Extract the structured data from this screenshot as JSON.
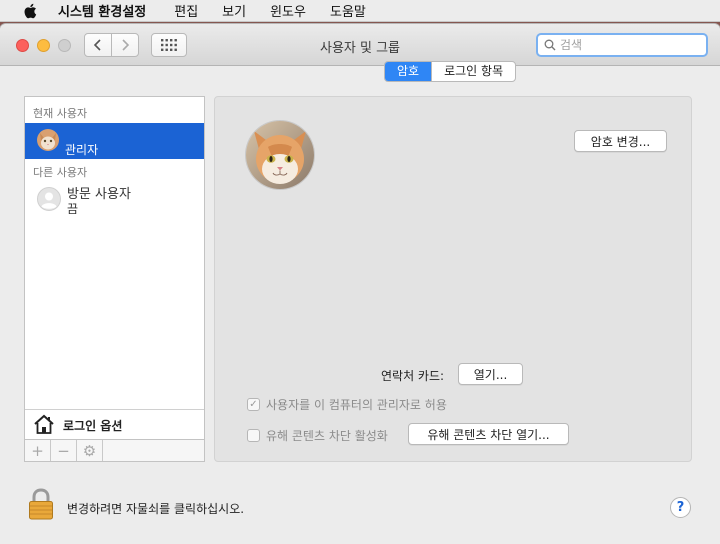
{
  "menubar": {
    "app_name": "시스템 환경설정",
    "items": [
      "편집",
      "보기",
      "윈도우",
      "도움말"
    ]
  },
  "window": {
    "title": "사용자 및 그룹"
  },
  "search": {
    "placeholder": "검색"
  },
  "sidebar": {
    "current_section": "현재 사용자",
    "current_user": "관리자",
    "other_section": "다른 사용자",
    "guest_name": "방문 사용자",
    "guest_status": "끔",
    "login_options": "로그인 옵션",
    "tools": [
      "+",
      "−",
      "⚙"
    ]
  },
  "tabs": [
    {
      "label": "암호",
      "active": true
    },
    {
      "label": "로그인 항목",
      "active": false
    }
  ],
  "panel": {
    "change_password": "암호 변경...",
    "contact_card_label": "연락처 카드:",
    "open_button": "열기...",
    "allow_admin": "사용자를 이 컴퓨터의 관리자로 허용",
    "parental_controls": "유해 콘텐츠 차단 활성화",
    "open_parental": "유해 콘텐츠 차단 열기..."
  },
  "footer": {
    "lock_text": "변경하려면 자물쇠를 클릭하십시오.",
    "help": "?"
  },
  "colors": {
    "accent": "#2f86f5",
    "selection": "#1b63d4"
  }
}
